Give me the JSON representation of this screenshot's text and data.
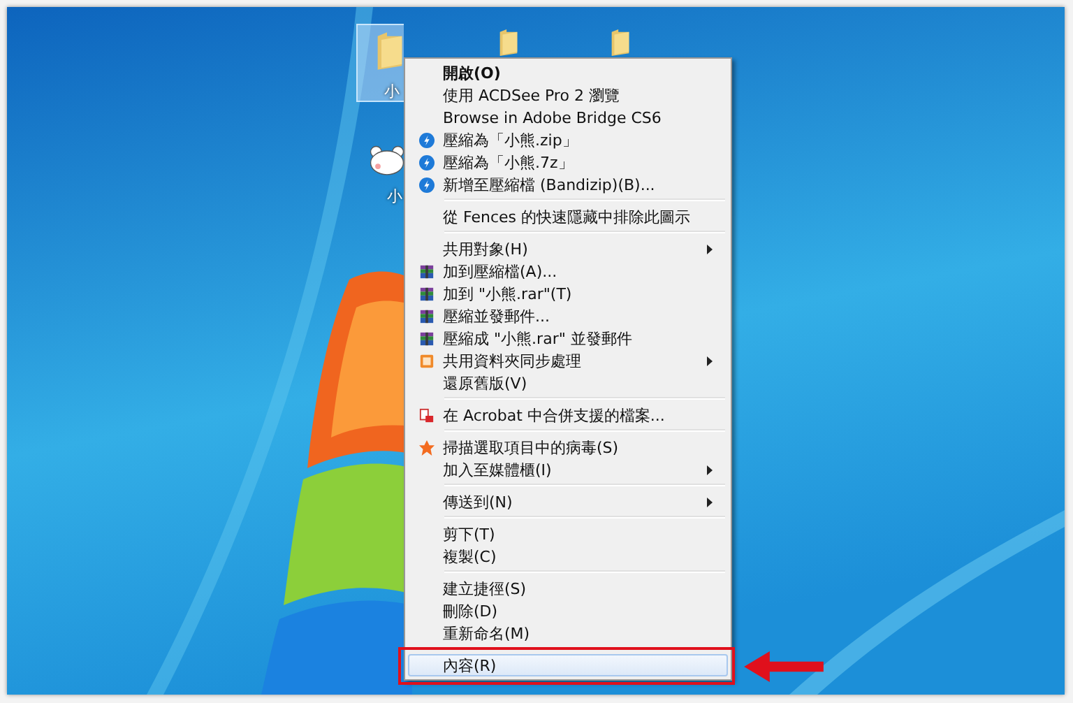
{
  "desktop_icons": [
    {
      "kind": "folder",
      "label": "小",
      "selected": true
    },
    {
      "kind": "folder",
      "selected": false
    },
    {
      "kind": "folder",
      "selected": false
    },
    {
      "kind": "bear",
      "label": "小",
      "selected": false
    }
  ],
  "context_menu": {
    "groups": [
      {
        "items": [
          {
            "label": "開啟(O)",
            "selected": false,
            "bold": true
          },
          {
            "label": "使用 ACDSee Pro 2 瀏覽",
            "selected": false
          },
          {
            "label": "Browse in Adobe Bridge CS6",
            "selected": false
          },
          {
            "label": "壓縮為「小熊.zip」",
            "kind": "bandizip",
            "selected": false
          },
          {
            "label": "壓縮為「小熊.7z」",
            "kind": "bandizip",
            "selected": false
          },
          {
            "label": "新增至壓縮檔 (Bandizip)(B)...",
            "kind": "bandizip",
            "selected": false
          }
        ]
      },
      {
        "items": [
          {
            "label": "從 Fences 的快速隱藏中排除此圖示",
            "selected": false
          }
        ]
      },
      {
        "items": [
          {
            "label": "共用對象(H)",
            "submenu": true,
            "selected": false
          },
          {
            "label": "加到壓縮檔(A)...",
            "kind": "winrar",
            "selected": false
          },
          {
            "label": "加到 \"小熊.rar\"(T)",
            "kind": "winrar",
            "selected": false
          },
          {
            "label": "壓縮並發郵件...",
            "kind": "winrar",
            "selected": false
          },
          {
            "label": "壓縮成 \"小熊.rar\" 並發郵件",
            "kind": "winrar",
            "selected": false
          },
          {
            "label": "共用資料夾同步處理",
            "kind": "sync",
            "submenu": true,
            "selected": false
          },
          {
            "label": "還原舊版(V)",
            "selected": false
          }
        ]
      },
      {
        "items": [
          {
            "label": "在 Acrobat 中合併支援的檔案...",
            "kind": "acrobat",
            "selected": false
          }
        ]
      },
      {
        "items": [
          {
            "label": "掃描選取項目中的病毒(S)",
            "kind": "avast",
            "selected": false
          },
          {
            "label": "加入至媒體櫃(I)",
            "submenu": true,
            "selected": false
          }
        ]
      },
      {
        "items": [
          {
            "label": "傳送到(N)",
            "submenu": true,
            "selected": false
          }
        ]
      },
      {
        "items": [
          {
            "label": "剪下(T)",
            "selected": false
          },
          {
            "label": "複製(C)",
            "selected": false
          }
        ]
      },
      {
        "items": [
          {
            "label": "建立捷徑(S)",
            "selected": false
          },
          {
            "label": "刪除(D)",
            "selected": false
          },
          {
            "label": "重新命名(M)",
            "selected": false
          }
        ]
      },
      {
        "items": [
          {
            "label": "內容(R)",
            "selected": true
          }
        ]
      }
    ]
  }
}
